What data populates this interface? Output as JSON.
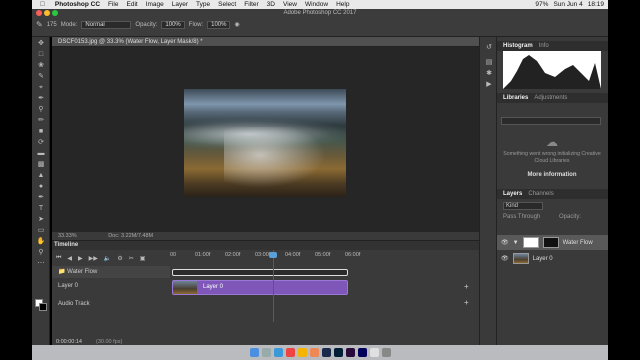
{
  "menubar": {
    "apple": "",
    "app_name": "Photoshop CC",
    "items": [
      "File",
      "Edit",
      "Image",
      "Layer",
      "Type",
      "Select",
      "Filter",
      "3D",
      "View",
      "Window",
      "Help"
    ],
    "status": [
      "97%",
      "Sun Jun 4",
      "18:19"
    ]
  },
  "window_title": "Adobe Photoshop CC 2017",
  "options": {
    "size": "175",
    "mode_label": "Mode:",
    "mode_value": "Normal",
    "opacity_label": "Opacity:",
    "opacity_value": "100%",
    "flow_label": "Flow:",
    "flow_value": "100%"
  },
  "document": {
    "tab_title": "DSCF0153.jpg @ 33.3% (Water Flow, Layer Mask/8) *",
    "zoom": "33.33%",
    "doc_info": "Doc: 3.22M/7.48M"
  },
  "timeline": {
    "title": "Timeline",
    "ruler": [
      "00",
      "01:00f",
      "02:00f",
      "03:00f",
      "04:00f",
      "05:00f",
      "06:00f"
    ],
    "tracks": [
      "Water Flow",
      "Layer 0",
      "Audio Track"
    ],
    "clip_label": "Layer 0",
    "timecode": "0:00:00:14",
    "fps": "(30.00 fps)"
  },
  "panels": {
    "tabs_top": [
      "Histogram",
      "Info"
    ],
    "tabs_lib": [
      "Libraries",
      "Adjustments"
    ],
    "lib_message": "Something went wrong initializing Creative Cloud Libraries",
    "more_info": "More information",
    "tabs_layers": [
      "Layers",
      "Channels"
    ],
    "kind": "Kind",
    "blend": "Pass Through",
    "opacity": "Opacity:",
    "layers": [
      "Water Flow",
      "Layer 0"
    ]
  }
}
